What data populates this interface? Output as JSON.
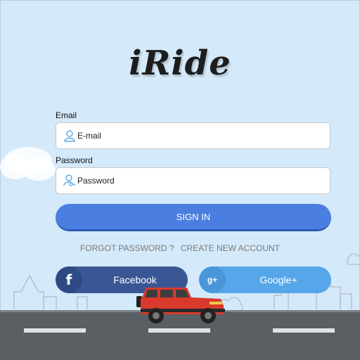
{
  "app": {
    "logo_text": "iRide"
  },
  "form": {
    "email_label": "Email",
    "email_placeholder": "E-mail",
    "password_label": "Password",
    "password_placeholder": "Password",
    "signin_label": "SIGN IN"
  },
  "links": {
    "forgot_password": "FORGOT PASSWORD ?",
    "create_account": "CREATE NEW ACCOUNT"
  },
  "social": {
    "facebook_label": "Facebook",
    "facebook_icon": "f",
    "google_label": "Google+",
    "google_icon": "g+"
  },
  "colors": {
    "background": "#d4e9f9",
    "signin_button": "#4a7ee0",
    "facebook": "#3a5795",
    "google": "#56a6ea",
    "road": "#595f63",
    "car_body": "#d93a2b"
  },
  "icons": {
    "email_field": "user-icon",
    "password_field": "user-key-icon"
  }
}
